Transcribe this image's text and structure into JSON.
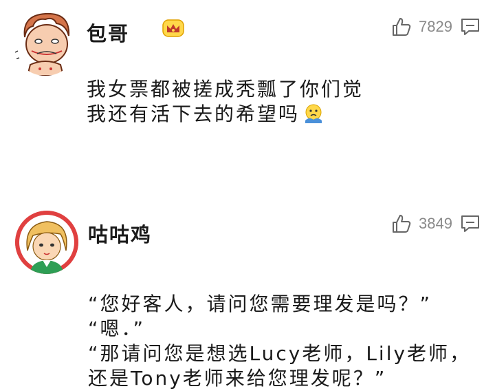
{
  "comments": [
    {
      "username": "包哥",
      "badge": "crown-icon",
      "likes": "7829",
      "lines": [
        "我女票都被搓成秃瓢了你们觉",
        "我还有活下去的希望吗"
      ],
      "trailing_emoji": "worried-face-emoji"
    },
    {
      "username": "咕咕鸡",
      "likes": "3849",
      "lines": [
        "“您好客人，请问您需要理发是吗？”",
        "“嗯．”",
        "“那请问您是想选Lucy老师，Lily老师，",
        "还是Tony老师来给您理发呢？”"
      ]
    }
  ],
  "colors": {
    "like_count": "#8a8a8a",
    "avatar2_ring": "#e04040",
    "crown": "#f0b400"
  }
}
